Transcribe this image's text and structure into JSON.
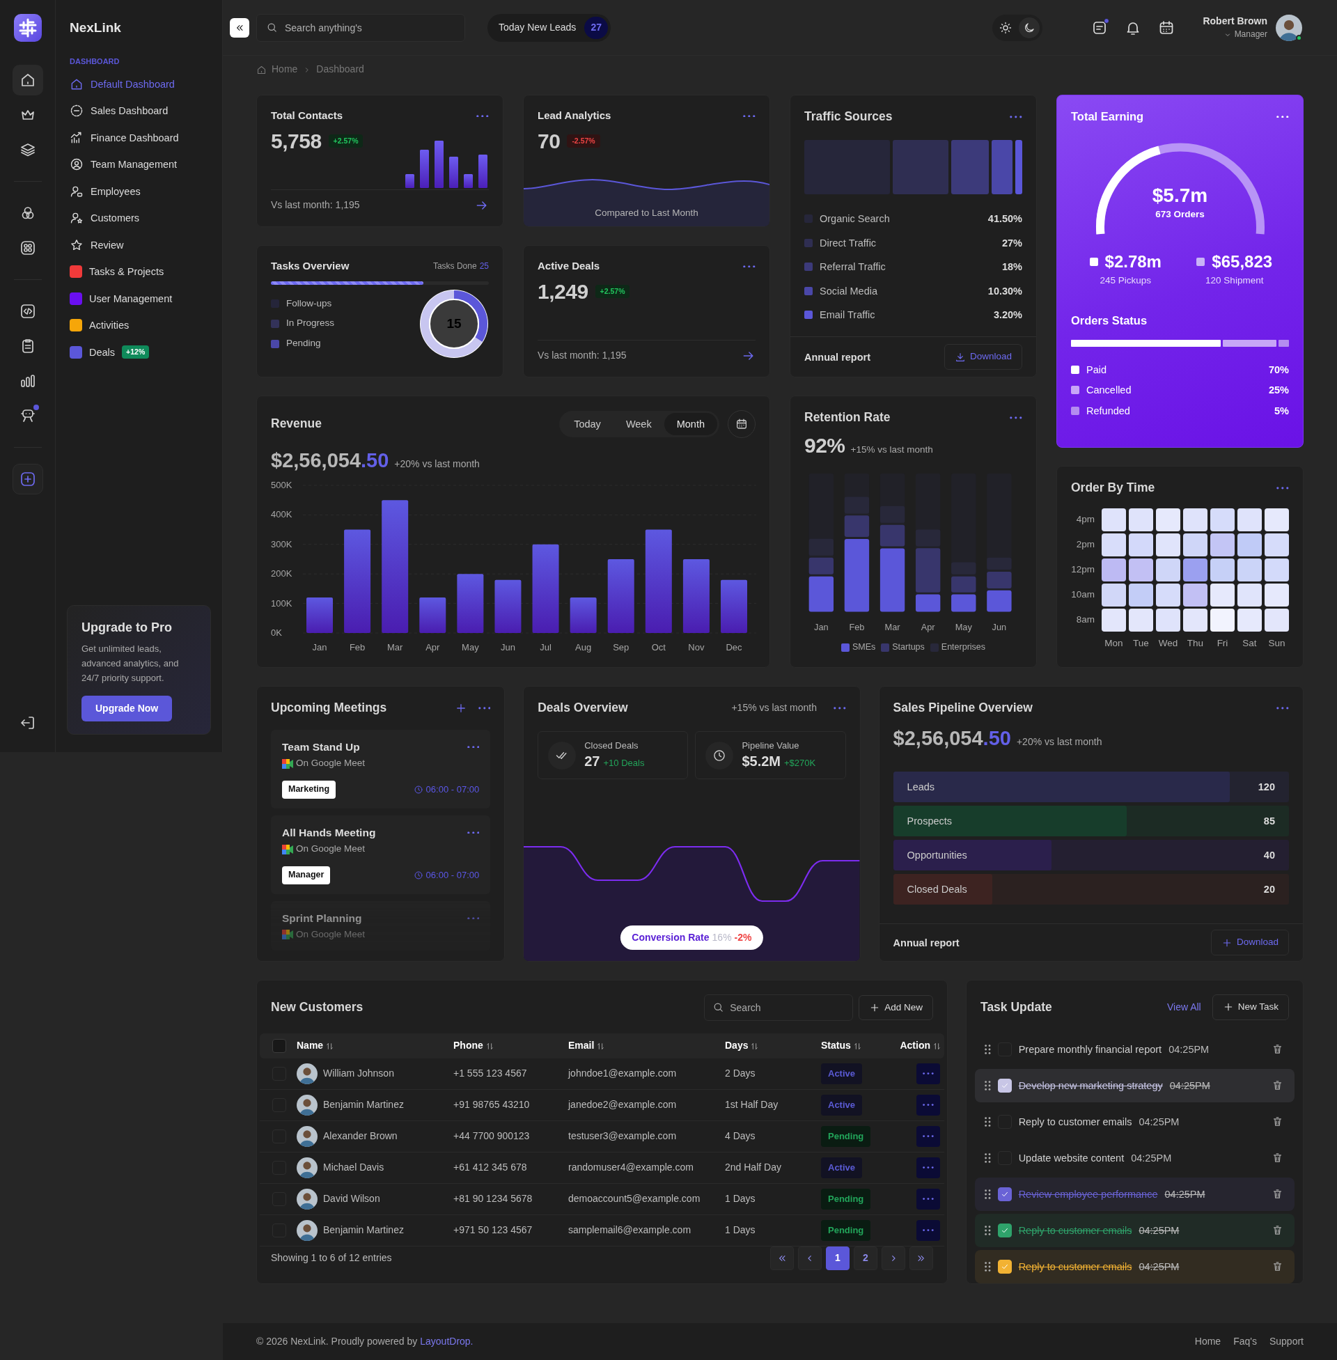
{
  "brand": {
    "name": "NexLink"
  },
  "rail": [
    {
      "selected": true,
      "notification": false
    },
    {
      "selected": false,
      "notification": false
    },
    {
      "selected": false,
      "notification": false
    },
    {
      "selected": false,
      "notification": false
    },
    {
      "selected": false,
      "notification": false
    },
    {
      "selected": false,
      "notification": false
    },
    {
      "selected": false,
      "notification": false
    },
    {
      "selected": false,
      "notification": false
    },
    {
      "selected": false,
      "notification": true
    },
    {
      "selected": false,
      "notification": false
    },
    {
      "selected": false,
      "notification": false
    }
  ],
  "nav": {
    "section": "DASHBOARD",
    "items": [
      {
        "label": "Default Dashboard",
        "selected": true
      },
      {
        "label": "Sales Dashboard",
        "selected": false
      },
      {
        "label": "Finance Dashboard",
        "selected": false
      },
      {
        "label": "Team Management",
        "selected": false
      },
      {
        "label": "Employees",
        "selected": false
      },
      {
        "label": "Customers",
        "selected": false
      },
      {
        "label": "Review",
        "selected": false
      },
      {
        "label": "Tasks & Projects",
        "selected": false,
        "color": "#f03a3a"
      },
      {
        "label": "User Management",
        "selected": false,
        "color": "#6a0ff0"
      },
      {
        "label": "Activities",
        "selected": false,
        "color": "#f6a609"
      },
      {
        "label": "Deals",
        "selected": false,
        "color": "#5b57d9",
        "badge": "+12%"
      }
    ]
  },
  "upgrade": {
    "title": "Upgrade to Pro",
    "text": "Get unlimited leads, advanced analytics, and 24/7 priority support.",
    "button": "Upgrade Now"
  },
  "header": {
    "search": {
      "placeholder": "Search anything's"
    },
    "leads": {
      "label": "Today New Leads",
      "count": "27"
    },
    "theme": [
      {
        "selected": false
      },
      {
        "selected": true
      }
    ],
    "icons": [
      {
        "notification": true
      },
      {
        "notification": false
      },
      {
        "notification": false
      }
    ],
    "user": {
      "name": "Robert Brown",
      "role": "Manager",
      "online": true
    }
  },
  "breadcrumb": [
    "Home",
    "Dashboard"
  ],
  "total_contacts": {
    "title": "Total Contacts",
    "value": "5,758",
    "change": "+2.57%",
    "color": "#22c55e",
    "footer": "Vs last month: 1,195"
  },
  "lead_analytics": {
    "title": "Lead Analytics",
    "value": "70",
    "change": "-2.57%",
    "color": "#ef4444",
    "caption": "Compared to Last Month"
  },
  "tasks_overview": {
    "title": "Tasks Overview",
    "done_label": "Tasks Done",
    "done_count": "25",
    "level": 0.7,
    "total": "15",
    "legend": [
      {
        "label": "Follow-ups",
        "color": "#25253a"
      },
      {
        "label": "In Progress",
        "color": "#333259"
      },
      {
        "label": "Pending",
        "color": "#4a47a8"
      }
    ]
  },
  "active_deals": {
    "title": "Active Deals",
    "value": "1,249",
    "change": "+2.57%",
    "color": "#22c55e",
    "footer": "Vs last month: 1,195"
  },
  "traffic_sources": {
    "title": "Traffic Sources",
    "items": [
      {
        "label": "Organic Search",
        "value": "41.50%",
        "color": "#26263a"
      },
      {
        "label": "Direct Traffic",
        "value": "27%",
        "color": "#2f2e52"
      },
      {
        "label": "Referral Traffic",
        "value": "18%",
        "color": "#3c3a7a"
      },
      {
        "label": "Social Media",
        "value": "10.30%",
        "color": "#4a47a8"
      },
      {
        "label": "Email Traffic",
        "value": "3.20%",
        "color": "#5b57d9"
      }
    ],
    "footer": "Annual report",
    "download": "Download"
  },
  "total_earning": {
    "title": "Total Earning",
    "gauge_value": "$5.7m",
    "gauge_caption": "673 Orders",
    "stats": [
      {
        "value": "$2.78m",
        "caption": "245 Pickups",
        "color": "#ffffff"
      },
      {
        "value": "$65,823",
        "caption": "120 Shipment",
        "color": "#c9b3f7"
      }
    ],
    "status_title": "Orders Status",
    "statuses": [
      {
        "label": "Paid",
        "value": "70%",
        "color": "#ffffff"
      },
      {
        "label": "Cancelled",
        "value": "25%",
        "color": "#c7a6f7"
      },
      {
        "label": "Refunded",
        "value": "5%",
        "color": "#b48cf0"
      }
    ]
  },
  "revenue": {
    "title": "Revenue",
    "ranges": [
      {
        "label": "Today",
        "selected": false
      },
      {
        "label": "Week",
        "selected": false
      },
      {
        "label": "Month",
        "selected": true
      }
    ],
    "amount": "$2,56,054",
    "cents": ".50",
    "change": "+20% vs last month",
    "chart_data": {
      "type": "bar",
      "categories": [
        "Jan",
        "Feb",
        "Mar",
        "Apr",
        "May",
        "Jun",
        "Jul",
        "Aug",
        "Sep",
        "Oct",
        "Nov",
        "Dec"
      ],
      "values": [
        120000,
        350000,
        450000,
        120000,
        200000,
        180000,
        300000,
        120000,
        250000,
        350000,
        250000,
        180000
      ],
      "ylim": [
        0,
        500000
      ],
      "grid": true,
      "yticks": [
        {
          "value": 0,
          "label": "0K"
        },
        {
          "value": 100000,
          "label": "100K"
        },
        {
          "value": 200000,
          "label": "200K"
        },
        {
          "value": 300000,
          "label": "300K"
        },
        {
          "value": 400000,
          "label": "400K"
        },
        {
          "value": 500000,
          "label": "500K"
        }
      ]
    }
  },
  "retention": {
    "title": "Retention Rate",
    "value": "92%",
    "change": "+15% vs last month",
    "months": [
      "Jan",
      "Feb",
      "Mar",
      "Apr",
      "May",
      "Jun"
    ],
    "legend": [
      {
        "label": "SMEs",
        "color": "#5b57d9"
      },
      {
        "label": "Startups",
        "color": "#38366c"
      },
      {
        "label": "Enterprises",
        "color": "#28283a"
      }
    ]
  },
  "order_by_time": {
    "title": "Order By Time",
    "hours": [
      "4pm",
      "2pm",
      "12pm",
      "10am",
      "8am"
    ],
    "days": [
      "Mon",
      "Tue",
      "Wed",
      "Thu",
      "Fri",
      "Sat",
      "Sun"
    ]
  },
  "meetings": {
    "title": "Upcoming Meetings",
    "items": [
      {
        "title": "Team Stand Up",
        "platform": "On Google Meet",
        "tag": "Marketing",
        "time": "06:00 - 07:00"
      },
      {
        "title": "All Hands Meeting",
        "platform": "On Google Meet",
        "tag": "Manager",
        "time": "06:00 - 07:00"
      },
      {
        "title": "Sprint Planning",
        "platform": "On Google Meet"
      }
    ]
  },
  "deals_overview": {
    "title": "Deals Overview",
    "change": "+15% vs last month",
    "stats": [
      {
        "label": "Closed Deals",
        "value": "27",
        "delta": "+10 Deals"
      },
      {
        "label": "Pipeline Value",
        "value": "$5.2M",
        "delta": "+$270K"
      }
    ],
    "conversion": {
      "label": "Conversion Rate",
      "value": "16%",
      "change": "-2%"
    }
  },
  "sales_pipeline": {
    "title": "Sales Pipeline Overview",
    "amount": "$2,56,054",
    "cents": ".50",
    "change": "+20% vs last month",
    "stages": [
      {
        "label": "Leads",
        "value": "120",
        "level": 0.85,
        "color": "#29294a"
      },
      {
        "label": "Prospects",
        "value": "85",
        "level": 0.59,
        "color": "#173d2b"
      },
      {
        "label": "Opportunities",
        "value": "40",
        "level": 0.4,
        "color": "#2b1f4c"
      },
      {
        "label": "Closed Deals",
        "value": "20",
        "level": 0.25,
        "color": "#3d2321"
      }
    ],
    "footer": "Annual report",
    "download": "Download"
  },
  "customers": {
    "title": "New Customers",
    "search": {
      "placeholder": "Search"
    },
    "add": "Add New",
    "all_checked": false,
    "columns": [
      "Name",
      "Phone",
      "Email",
      "Days",
      "Status",
      "Action"
    ],
    "rows": [
      {
        "checked": false,
        "name": "William Johnson",
        "phone": "+1 555 123 4567",
        "email": "johndoe1@example.com",
        "days": "2 Days",
        "status": "Active",
        "color": "#5b5bd6"
      },
      {
        "checked": false,
        "name": "Benjamin Martinez",
        "phone": "+91 98765 43210",
        "email": "janedoe2@example.com",
        "days": "1st Half Day",
        "status": "Active",
        "color": "#5b5bd6"
      },
      {
        "checked": false,
        "name": "Alexander Brown",
        "phone": "+44 7700 900123",
        "email": "testuser3@example.com",
        "days": "4 Days",
        "status": "Pending",
        "color": "#22a55a"
      },
      {
        "checked": false,
        "name": "Michael Davis",
        "phone": "+61 412 345 678",
        "email": "randomuser4@example.com",
        "days": "2nd Half Day",
        "status": "Active",
        "color": "#5b5bd6"
      },
      {
        "checked": false,
        "name": "David Wilson",
        "phone": "+81 90 1234 5678",
        "email": "demoaccount5@example.com",
        "days": "1 Days",
        "status": "Pending",
        "color": "#22a55a"
      },
      {
        "checked": false,
        "name": "Benjamin Martinez",
        "phone": "+971 50 123 4567",
        "email": "samplemail6@example.com",
        "days": "1 Days",
        "status": "Pending",
        "color": "#22a55a"
      }
    ],
    "summary": "Showing 1 to 6 of 12 entries",
    "pages": [
      {
        "label": "1",
        "selected": true
      },
      {
        "label": "2",
        "selected": false
      }
    ]
  },
  "task_update": {
    "title": "Task Update",
    "view_all": "View All",
    "new_task": "New Task",
    "tasks": [
      {
        "text": "Prepare monthly financial report",
        "time": "04:25PM",
        "checked": false
      },
      {
        "text": "Develop new marketing strategy",
        "time": "04:25PM",
        "checked": true,
        "color": "#c8c6e6"
      },
      {
        "text": "Reply to customer emails",
        "time": "04:25PM",
        "checked": false
      },
      {
        "text": "Update website content",
        "time": "04:25PM",
        "checked": false
      },
      {
        "text": "Review employee performance",
        "time": "04:25PM",
        "checked": true,
        "color": "#6a63d6"
      },
      {
        "text": "Reply to customer emails",
        "time": "04:25PM",
        "checked": true,
        "color": "#2fa36b"
      },
      {
        "text": "Reply to customer emails",
        "time": "04:25PM",
        "checked": true,
        "color": "#f2b233"
      }
    ]
  },
  "footer": {
    "text": "© 2026 NexLink. Proudly powered by",
    "link": "LayoutDrop.",
    "links": [
      "Home",
      "Faq's",
      "Support"
    ]
  }
}
